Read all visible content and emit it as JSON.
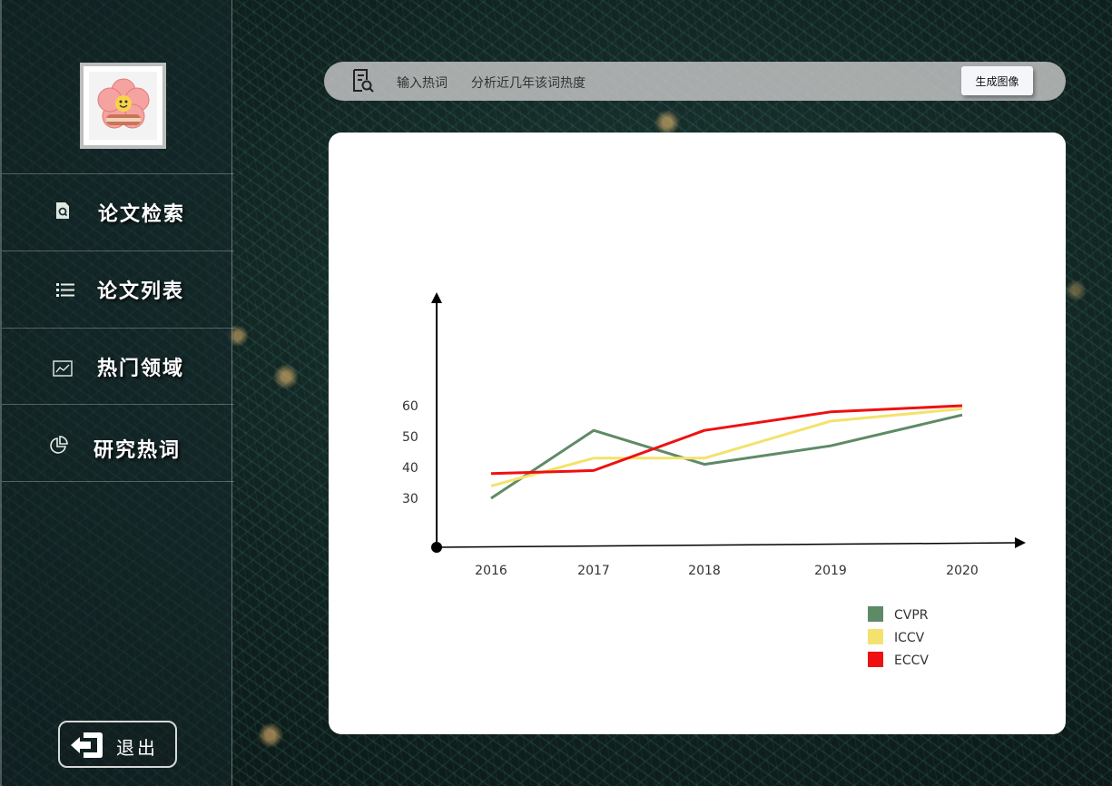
{
  "sidebar": {
    "items": [
      {
        "label": "论文检索",
        "icon": "document-search-icon"
      },
      {
        "label": "论文列表",
        "icon": "list-icon"
      },
      {
        "label": "热门领域",
        "icon": "line-chart-icon"
      },
      {
        "label": "研究热词",
        "icon": "pie-chart-icon"
      }
    ],
    "logout_label": "退出",
    "logout_icon": "exit-door-icon",
    "avatar_icon": "flower-avatar-icon"
  },
  "searchbar": {
    "icon": "search-document-icon",
    "placeholder_label": "输入热词",
    "hint": "分析近几年该词热度",
    "button_label": "生成图像"
  },
  "colors": {
    "CVPR": "#5e8a66",
    "ICCV": "#f4e26e",
    "ECCV": "#ee1111"
  },
  "chart_data": {
    "type": "line",
    "x": [
      "2016",
      "2017",
      "2018",
      "2019",
      "2020"
    ],
    "y_ticks": [
      30,
      40,
      50,
      60
    ],
    "series": [
      {
        "name": "CVPR",
        "values": [
          30,
          52,
          41,
          47,
          57
        ]
      },
      {
        "name": "ICCV",
        "values": [
          34,
          43,
          43,
          55,
          59
        ]
      },
      {
        "name": "ECCV",
        "values": [
          38,
          39,
          52,
          58,
          60
        ]
      }
    ],
    "legend_position": "bottom-right",
    "grid": false
  }
}
